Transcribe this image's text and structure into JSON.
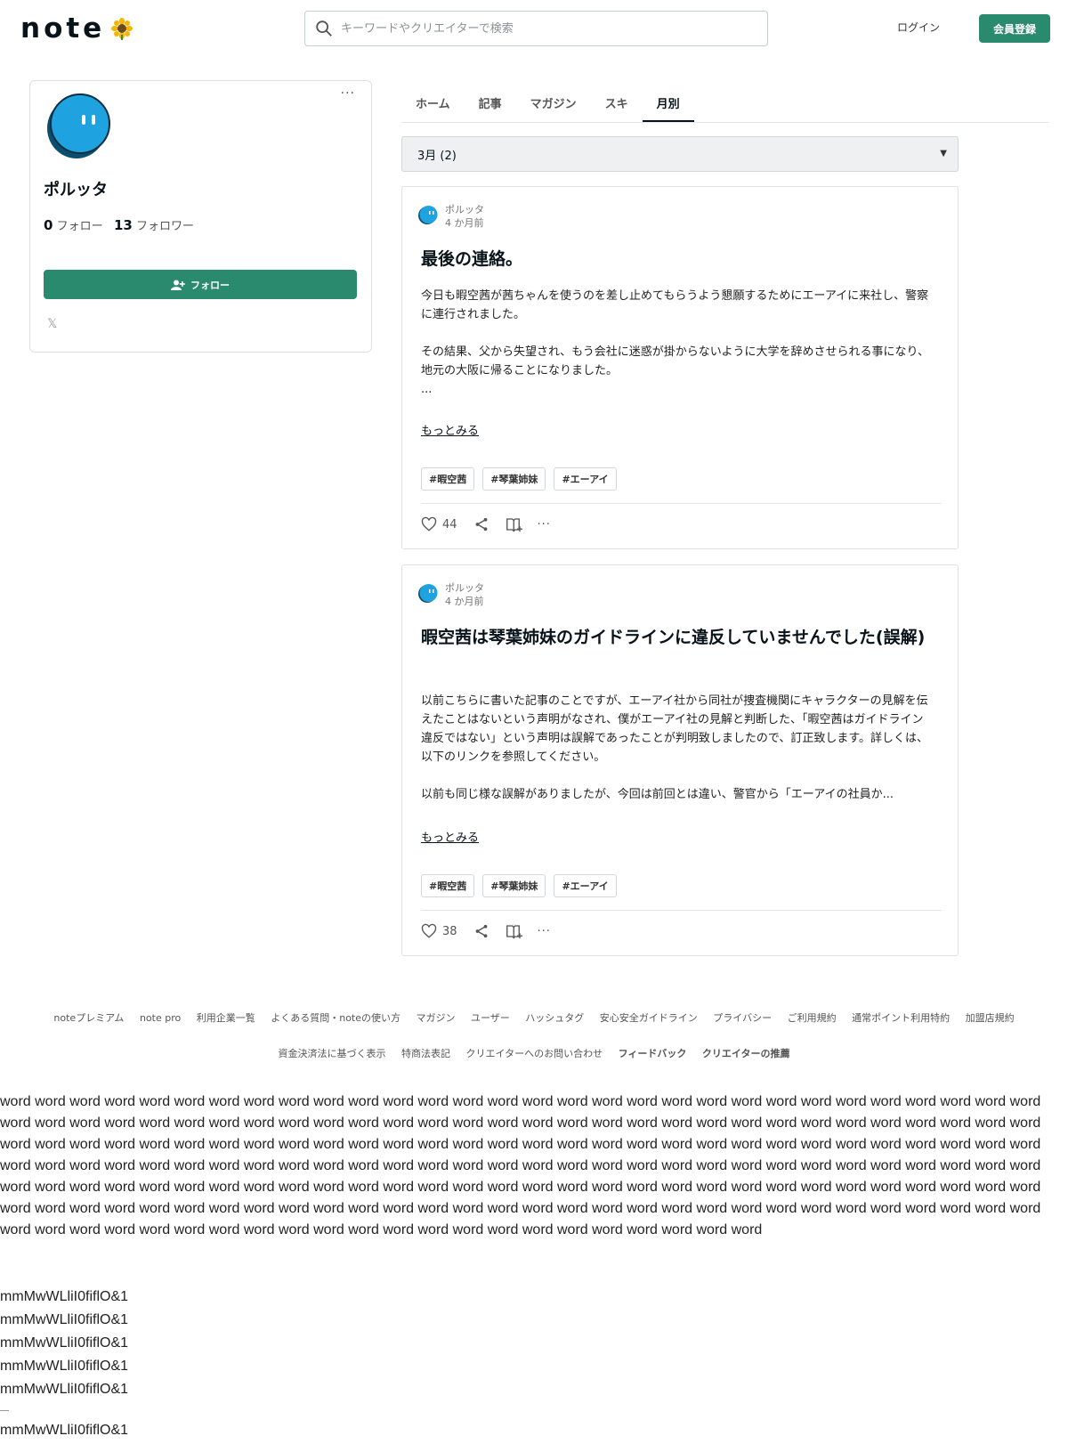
{
  "header": {
    "logo": "note",
    "search_placeholder": "キーワードやクリエイターで検索",
    "login": "ログイン",
    "signup": "会員登録"
  },
  "profile": {
    "name": "ポルッタ",
    "following_count": "0",
    "following_label": "フォロー",
    "followers_count": "13",
    "followers_label": "フォロワー",
    "follow_button": "フォロー",
    "more": "···"
  },
  "tabs": [
    "ホーム",
    "記事",
    "マガジン",
    "スキ",
    "月別"
  ],
  "active_tab": "月別",
  "month_select": "3月 (2)",
  "articles": [
    {
      "author": "ポルッタ",
      "time": "4 か月前",
      "title": "最後の連絡。",
      "body": [
        "今日も暇空茜が茜ちゃんを使うのを差し止めてもらうよう懇願するためにエーアイに来社し、警察に連行されました。",
        "",
        "その結果、父から失望され、もう会社に迷惑が掛からないように大学を辞めさせられる事になり、地元の大阪に帰ることになりました。",
        "..."
      ],
      "more": "もっとみる",
      "tags": [
        "#暇空茜",
        "#琴葉姉妹",
        "#エーアイ"
      ],
      "likes": "44"
    },
    {
      "author": "ポルッタ",
      "time": "4 か月前",
      "title": "暇空茜は琴葉姉妹のガイドラインに違反していませんでした(誤解)",
      "body": [
        "以前こちらに書いた記事のことですが、エーアイ社から同社が捜査機関にキャラクターの見解を伝えたことはないという声明がなされ、僕がエーアイ社の見解と判断した、「暇空茜はガイドライン違反ではない」という声明は誤解であったことが判明致しましたので、訂正致します。詳しくは、以下のリンクを参照してください。",
        "",
        "以前も同じ様な誤解がありましたが、今回は前回とは違い、警官から「エーアイの社員か..."
      ],
      "more": "もっとみる",
      "tags": [
        "#暇空茜",
        "#琴葉姉妹",
        "#エーアイ"
      ],
      "likes": "38"
    }
  ],
  "footer": {
    "row1": [
      "noteプレミアム",
      "note pro",
      "利用企業一覧",
      "よくある質問・noteの使い方",
      "マガジン",
      "ユーザー",
      "ハッシュタグ",
      "安心安全ガイドライン",
      "プライバシー",
      "ご利用規約",
      "通常ポイント利用特約",
      "加盟店規約"
    ],
    "row2": [
      "資金決済法に基づく表示",
      "特商法表記",
      "クリエイターへのお問い合わせ"
    ],
    "row2_bold": [
      "フィードバック",
      "クリエイターの推薦"
    ]
  },
  "test_text": {
    "words": "word word word word word word word word word word word word word word word word word word word word word word word word word word word word word word word word word word word word word word word word word word word word word word word word word word word word word word word word word word word word word word word word word word word word word word word word word word word word word word word word word word word word word word word word word word word word word word word word word word word word word word word word word word word word word word word word word word word word word word word word word word word word word word word word word word word word word word word word word word word word word word word word word word word word word word word word word word word word word word word word word word word word word word word word word word word word word word word word word word word word word word word word word word word word word word word word word word word word word word word word word word",
    "glyph_line": "mmMwWLliI0fiflO&1"
  }
}
